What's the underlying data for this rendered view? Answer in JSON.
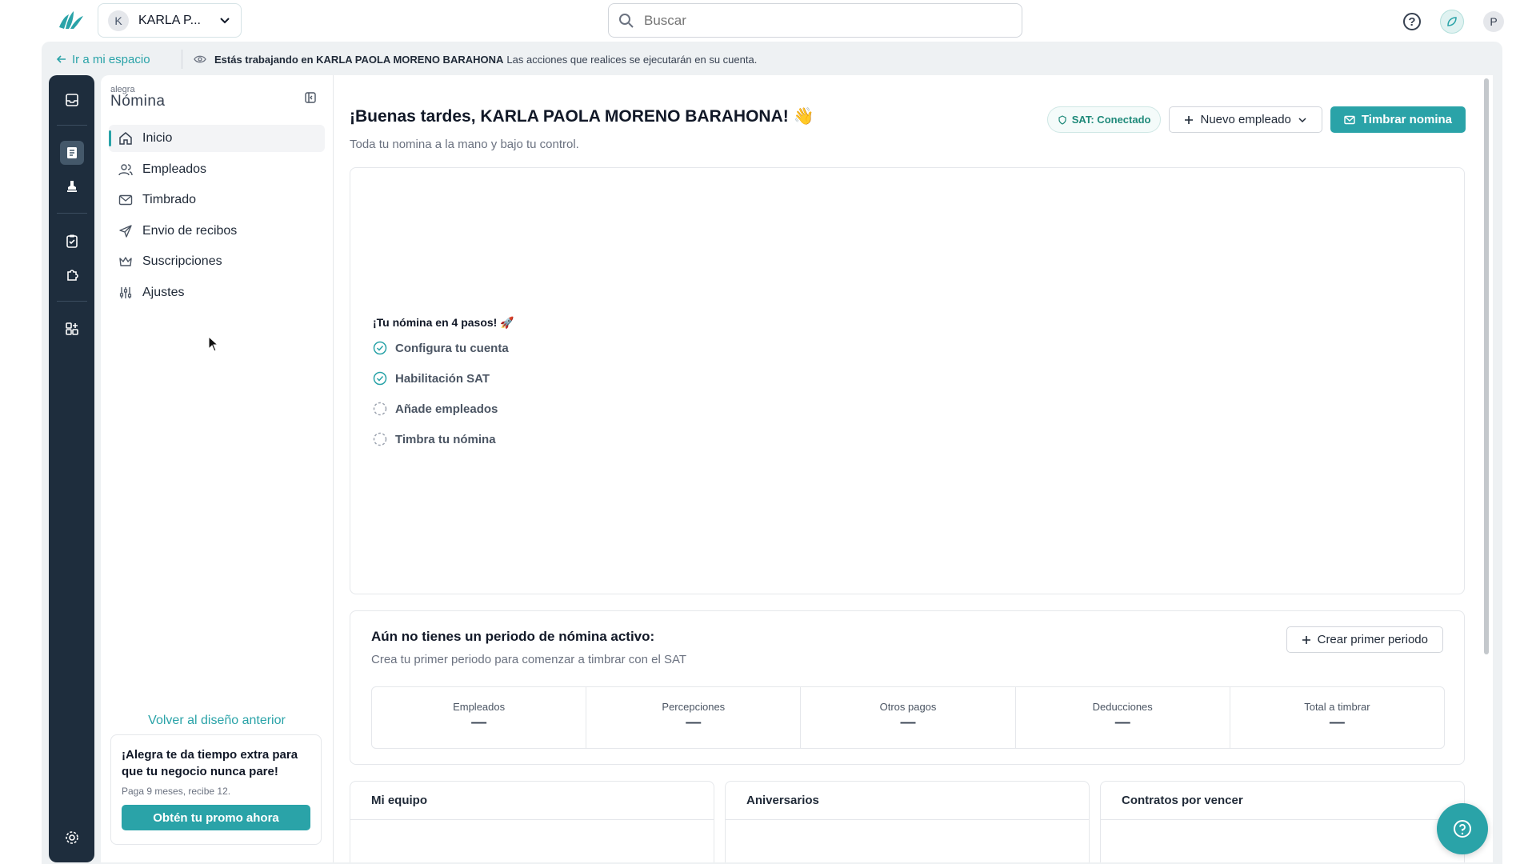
{
  "topbar": {
    "account_initial": "K",
    "account_name": "KARLA P...",
    "search_placeholder": "Buscar",
    "user_initial": "P"
  },
  "impersonation": {
    "back_link": "Ir a mi espacio",
    "message_strong": "Estás trabajando en KARLA PAOLA MORENO BARAHONA",
    "message_rest": "Las acciones que realices se ejecutarán en su cuenta."
  },
  "brand": {
    "small": "alegra",
    "big": "Nómina"
  },
  "sidebar": {
    "items": [
      {
        "label": "Inicio",
        "icon": "home-icon",
        "active": true
      },
      {
        "label": "Empleados",
        "icon": "users-icon"
      },
      {
        "label": "Timbrado",
        "icon": "mail-icon"
      },
      {
        "label": "Envio de recibos",
        "icon": "send-icon"
      },
      {
        "label": "Suscripciones",
        "icon": "crown-icon"
      },
      {
        "label": "Ajustes",
        "icon": "sliders-icon"
      }
    ],
    "back_design": "Volver al diseño anterior",
    "promo": {
      "title": "¡Alegra te da tiempo extra para que tu negocio nunca pare!",
      "subtitle": "Paga 9 meses, recibe 12.",
      "button": "Obtén tu promo ahora"
    }
  },
  "main": {
    "greeting": "¡Buenas tardes, KARLA PAOLA MORENO BARAHONA! 👋",
    "subtitle": "Toda tu nomina a la mano y bajo tu control.",
    "sat_badge": "SAT: Conectado",
    "new_employee": "Nuevo empleado",
    "stamp_payroll": "Timbrar nomina",
    "steps_title": "¡Tu nómina en 4 pasos! 🚀",
    "steps": [
      {
        "label": "Configura tu cuenta",
        "done": true
      },
      {
        "label": "Habilitación SAT",
        "done": true
      },
      {
        "label": "Añade empleados",
        "done": false
      },
      {
        "label": "Timbra tu nómina",
        "done": false
      }
    ],
    "period": {
      "title": "Aún no tienes un periodo de nómina activo:",
      "subtitle": "Crea tu primer periodo para comenzar a timbrar con el SAT",
      "button": "Crear primer periodo",
      "stats": [
        {
          "label": "Empleados",
          "value": "—"
        },
        {
          "label": "Percepciones",
          "value": "—"
        },
        {
          "label": "Otros pagos",
          "value": "—"
        },
        {
          "label": "Deducciones",
          "value": "—"
        },
        {
          "label": "Total a timbrar",
          "value": "—"
        }
      ]
    },
    "cards": [
      "Mi equipo",
      "Aniversarios",
      "Contratos por vencer"
    ]
  },
  "colors": {
    "accent": "#2aa3a8",
    "rail": "#1e2d3d",
    "frame": "#eef1f3"
  }
}
